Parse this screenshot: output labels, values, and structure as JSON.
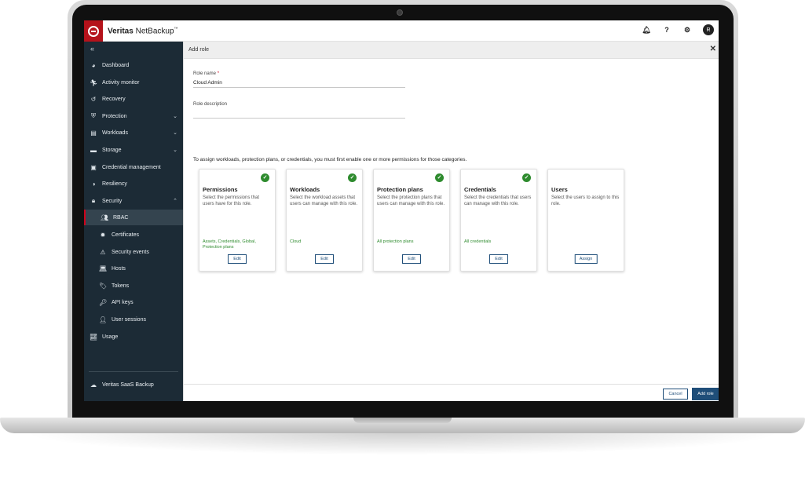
{
  "app": {
    "title_bold": "Veritas",
    "title_rest": " NetBackup",
    "trademark": "™",
    "avatar_initial": "R"
  },
  "topbar_icons": [
    "bell-icon",
    "help-icon",
    "gear-icon"
  ],
  "sidebar": {
    "collapse_icon": "«",
    "items": [
      {
        "label": "Dashboard",
        "icon": "dashboard-icon"
      },
      {
        "label": "Activity monitor",
        "icon": "activity-icon"
      },
      {
        "label": "Recovery",
        "icon": "recovery-icon"
      },
      {
        "label": "Protection",
        "icon": "shield-icon",
        "expandable": true
      },
      {
        "label": "Workloads",
        "icon": "briefcase-icon",
        "expandable": true
      },
      {
        "label": "Storage",
        "icon": "storage-icon",
        "expandable": true
      },
      {
        "label": "Credential management",
        "icon": "credential-icon"
      },
      {
        "label": "Resiliency",
        "icon": "resiliency-icon"
      },
      {
        "label": "Security",
        "icon": "lock-icon",
        "expanded": true
      },
      {
        "label": "RBAC",
        "icon": "users-icon",
        "sub": true,
        "active": true
      },
      {
        "label": "Certificates",
        "icon": "certificate-icon",
        "sub": true
      },
      {
        "label": "Security events",
        "icon": "warning-icon",
        "sub": true
      },
      {
        "label": "Hosts",
        "icon": "laptop-icon",
        "sub": true
      },
      {
        "label": "Tokens",
        "icon": "tag-icon",
        "sub": true
      },
      {
        "label": "API keys",
        "icon": "key-icon",
        "sub": true
      },
      {
        "label": "User sessions",
        "icon": "user-icon",
        "sub": true
      },
      {
        "label": "Usage",
        "icon": "chart-icon"
      }
    ],
    "saas": {
      "label": "Veritas SaaS Backup",
      "icon": "cloud-icon"
    }
  },
  "panel": {
    "title": "Add role",
    "role_name_label": "Role name",
    "required_mark": "*",
    "role_name_value": "Cloud Admin",
    "role_description_label": "Role description",
    "info": "To assign workloads, protection plans, or credentials, you must first enable one or more permissions for those categories."
  },
  "cards": [
    {
      "title": "Permissions",
      "desc": "Select the permissions that users have for this role.",
      "selected": "Assets, Credentials, Global, Protection plans",
      "button": "Edit",
      "checked": true
    },
    {
      "title": "Workloads",
      "desc": "Select the workload assets that users can manage with this role.",
      "selected": "Cloud",
      "button": "Edit",
      "checked": true
    },
    {
      "title": "Protection plans",
      "desc": "Select the protection plans that users can manage with this role.",
      "selected": "All protection plans",
      "button": "Edit",
      "checked": true
    },
    {
      "title": "Credentials",
      "desc": "Select the credentials that users can manage with this role.",
      "selected": "All credentials",
      "button": "Edit",
      "checked": true
    },
    {
      "title": "Users",
      "desc": "Select the users to assign to this role.",
      "selected": "",
      "button": "Assign",
      "checked": false
    }
  ],
  "footer": {
    "cancel": "Cancel",
    "add": "Add role"
  },
  "colors": {
    "brand_red": "#b5121b",
    "sidebar_bg": "#1c2b36",
    "primary_blue": "#1f4e79",
    "success_green": "#2e8b2e"
  }
}
